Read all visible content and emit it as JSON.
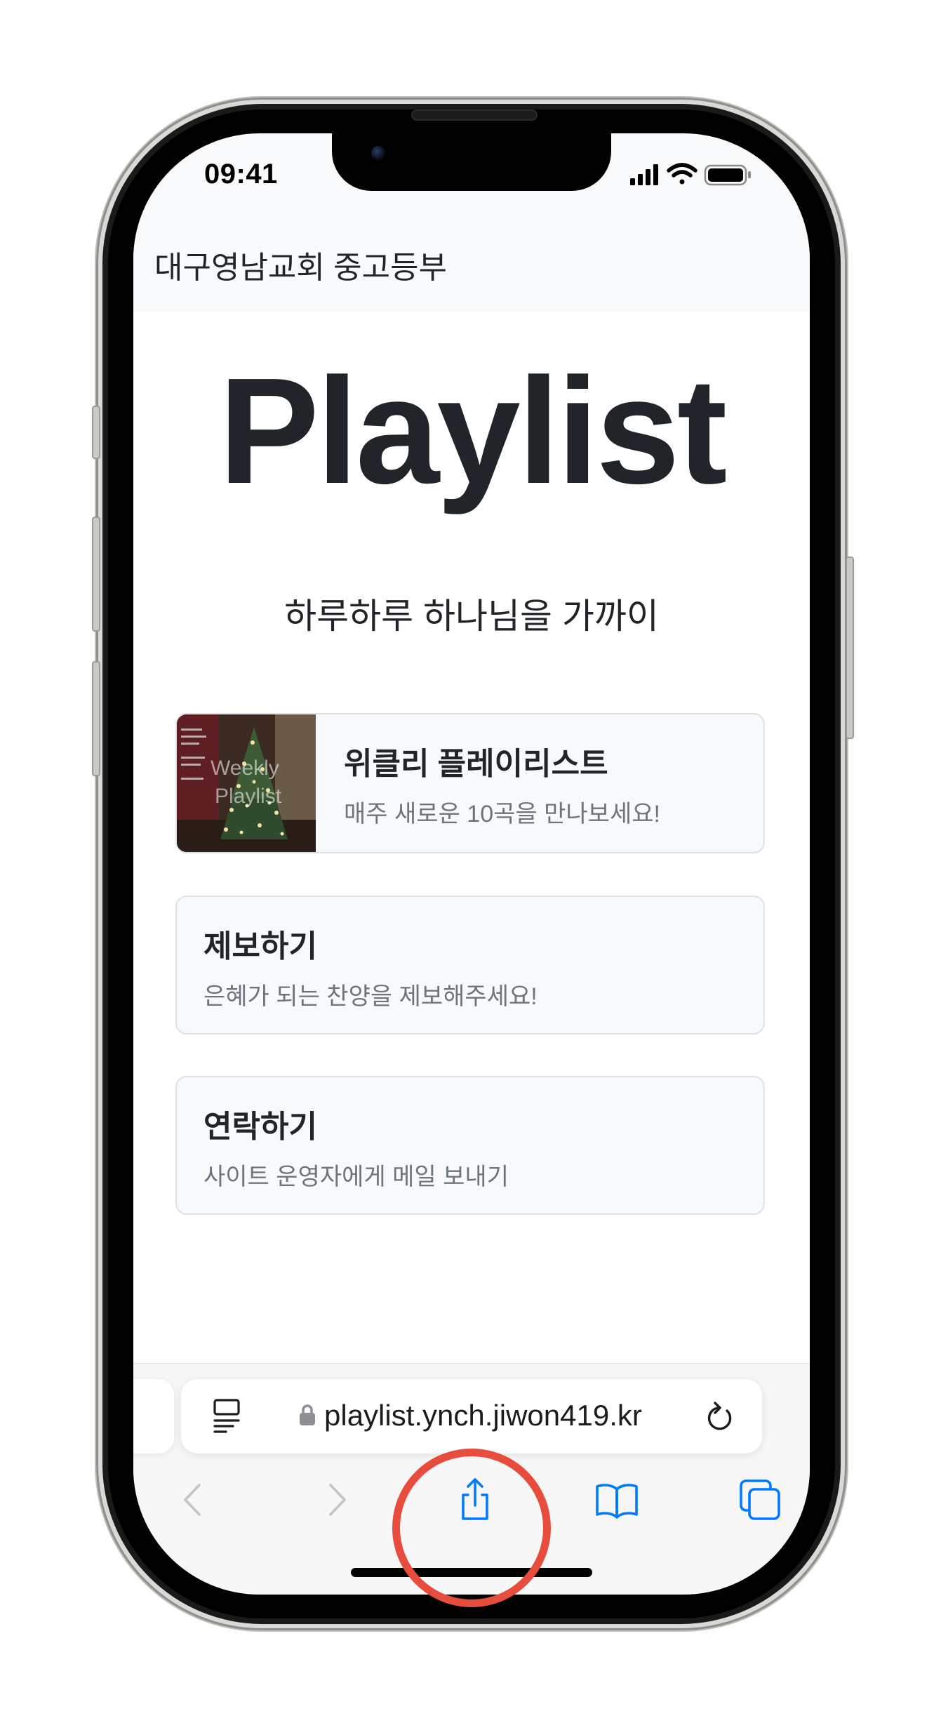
{
  "status_bar": {
    "time": "09:41",
    "icons": [
      "cellular-signal-icon",
      "wifi-icon",
      "battery-icon"
    ]
  },
  "header": {
    "title": "대구영남교회 중고등부"
  },
  "hero": {
    "title": "Playlist",
    "subtitle": "하루하루 하나님을 가까이"
  },
  "cards": {
    "weekly": {
      "title": "위클리 플레이리스트",
      "description": "매주 새로운 10곡을 만나보세요!",
      "thumb_line1": "Weekly",
      "thumb_line2": "Playlist"
    },
    "report": {
      "title": "제보하기",
      "description": "은혜가 되는 찬양을 제보해주세요!"
    },
    "contact": {
      "title": "연락하기",
      "description": "사이트 운영자에게 메일 보내기"
    }
  },
  "browser": {
    "url": "playlist.ynch.jiwon419.kr",
    "toolbar_icons": [
      "back-icon",
      "forward-icon",
      "share-icon",
      "bookmarks-icon",
      "tabs-icon"
    ],
    "accent_color": "#007aff",
    "highlight_color": "#e74c3c"
  }
}
